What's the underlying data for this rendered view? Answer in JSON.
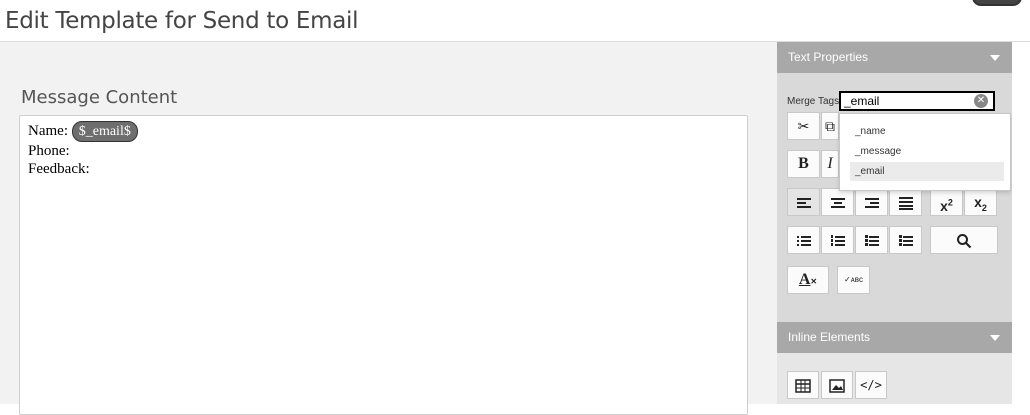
{
  "header": {
    "title": "Edit Template for Send to Email"
  },
  "main": {
    "section_label": "Message Content",
    "editor": {
      "line1_label": "Name:",
      "line1_tag": "$_email$",
      "line2_label": "Phone:",
      "line3_label": "Feedback:"
    }
  },
  "side": {
    "text_properties": {
      "title": "Text Properties",
      "merge_tags_label": "Merge Tags",
      "merge_tags_value": "_email",
      "dropdown_options": [
        "_name",
        "_message",
        "_email"
      ],
      "selected_option": "_email",
      "bold_label": "B",
      "italic_label": "I"
    },
    "inline_elements": {
      "title": "Inline Elements"
    },
    "colors": {
      "header_bg": "#a8a8a8",
      "panel_bg": "#d9d9d9",
      "chip_bg": "#6e6e6e"
    }
  }
}
